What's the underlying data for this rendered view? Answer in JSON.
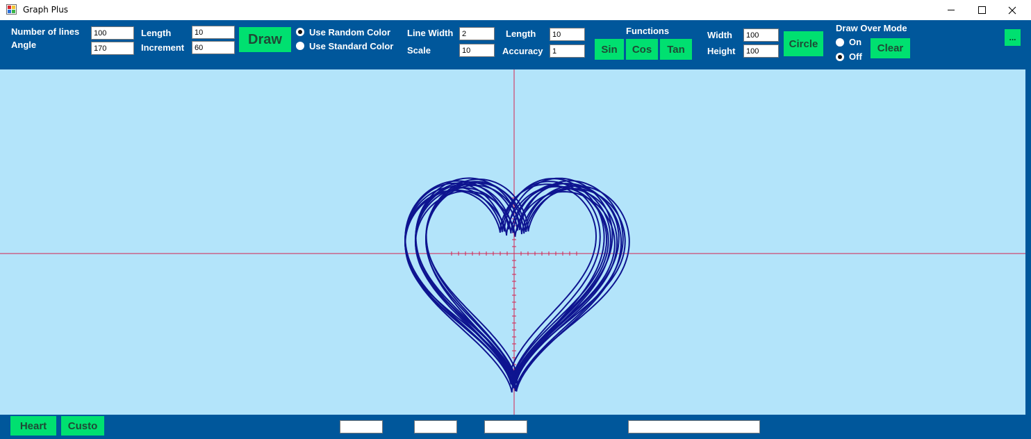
{
  "window": {
    "title": "Graph Plus",
    "controls": {
      "minimize": "–",
      "maximize": "☐",
      "close": "✕"
    }
  },
  "toolbar": {
    "lines_label": "Number of lines",
    "lines_value": "100",
    "angle_label": "Angle",
    "angle_value": "170",
    "length_label": "Length",
    "length_value": "10",
    "increment_label": "Increment",
    "increment_value": "60",
    "draw_button": "Draw",
    "random_color_label": "Use Random Color",
    "standard_color_label": "Use Standard Color",
    "color_mode_selected": "random",
    "line_width_label": "Line Width",
    "line_width_value": "2",
    "scale_label": "Scale",
    "scale_value": "10",
    "fn_length_label": "Length",
    "fn_length_value": "10",
    "accuracy_label": "Accuracy",
    "accuracy_value": "1",
    "functions_label": "Functions",
    "sin_button": "Sin",
    "cos_button": "Cos",
    "tan_button": "Tan",
    "width_label": "Width",
    "width_value": "100",
    "height_label": "Height",
    "height_value": "100",
    "circle_button": "Circle",
    "draw_over_label": "Draw Over Mode",
    "on_label": "On",
    "off_label": "Off",
    "draw_over_selected": "off",
    "clear_button": "Clear",
    "more_button": "..."
  },
  "bottom": {
    "heart_button": "Heart",
    "custom_button": "Custo",
    "field1_value": "",
    "field2_value": "",
    "field3_value": "",
    "field4_value": ""
  },
  "plot": {
    "curve_color": "#0e1490",
    "axis_color": "#d4224e",
    "background": "#b3e4fa",
    "curve_count": 14
  },
  "colors": {
    "toolbar": "#00579b",
    "button": "#00e070",
    "button_text": "#1f4a36"
  }
}
